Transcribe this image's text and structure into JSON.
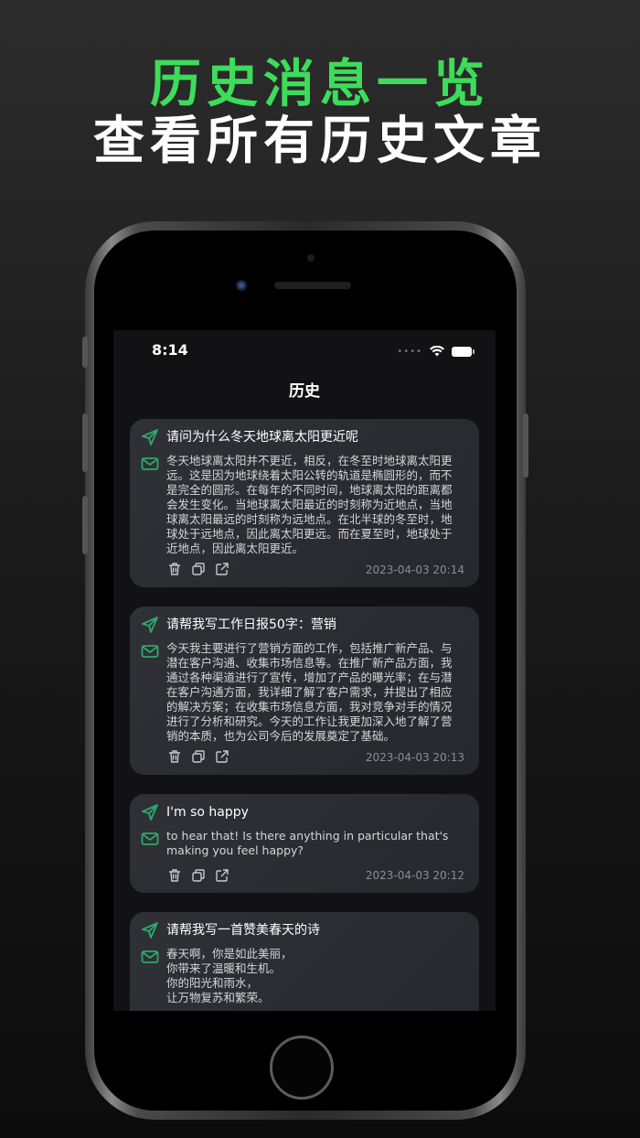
{
  "promo": {
    "line1": "历史消息一览",
    "line2": "查看所有历史文章",
    "accent": "#3ddc5b"
  },
  "status_bar": {
    "time": "8:14"
  },
  "nav": {
    "title": "历史"
  },
  "history": [
    {
      "question": "请问为什么冬天地球离太阳更近呢",
      "answer": "冬天地球离太阳并不更近，相反，在冬至时地球离太阳更\n远。这是因为地球绕着太阳公转的轨道是椭圆形的，而不\n是完全的圆形。在每年的不同时间，地球离太阳的距离都\n会发生变化。当地球离太阳最近的时刻称为近地点，当地\n球离太阳最远的时刻称为远地点。在北半球的冬至时，地\n球处于远地点，因此离太阳更远。而在夏至时，地球处于\n近地点，因此离太阳更近。",
      "time": "2023-04-03 20:14"
    },
    {
      "question": "请帮我写工作日报50字：营销",
      "answer": "今天我主要进行了营销方面的工作，包括推广新产品、与\n潜在客户沟通、收集市场信息等。在推广新产品方面，我\n通过各种渠道进行了宣传，增加了产品的曝光率；在与潜\n在客户沟通方面，我详细了解了客户需求，并提出了相应\n的解决方案；在收集市场信息方面，我对竞争对手的情况\n进行了分析和研究。今天的工作让我更加深入地了解了营\n销的本质，也为公司今后的发展奠定了基础。",
      "time": "2023-04-03 20:13"
    },
    {
      "question": "I'm so happy",
      "answer": "to hear that! Is there anything in particular that's\nmaking you feel happy?",
      "time": "2023-04-03 20:12"
    },
    {
      "question": "请帮我写一首赞美春天的诗",
      "answer": "春天啊，你是如此美丽，\n你带来了温暖和生机。\n你的阳光和雨水，\n让万物复苏和繁荣。",
      "time": ""
    }
  ],
  "icons": {
    "sent": "paper-plane-icon",
    "reply": "envelope-icon",
    "delete": "trash-icon",
    "copy": "copy-icon",
    "share": "share-icon",
    "icon_color": "#2fa86a"
  }
}
